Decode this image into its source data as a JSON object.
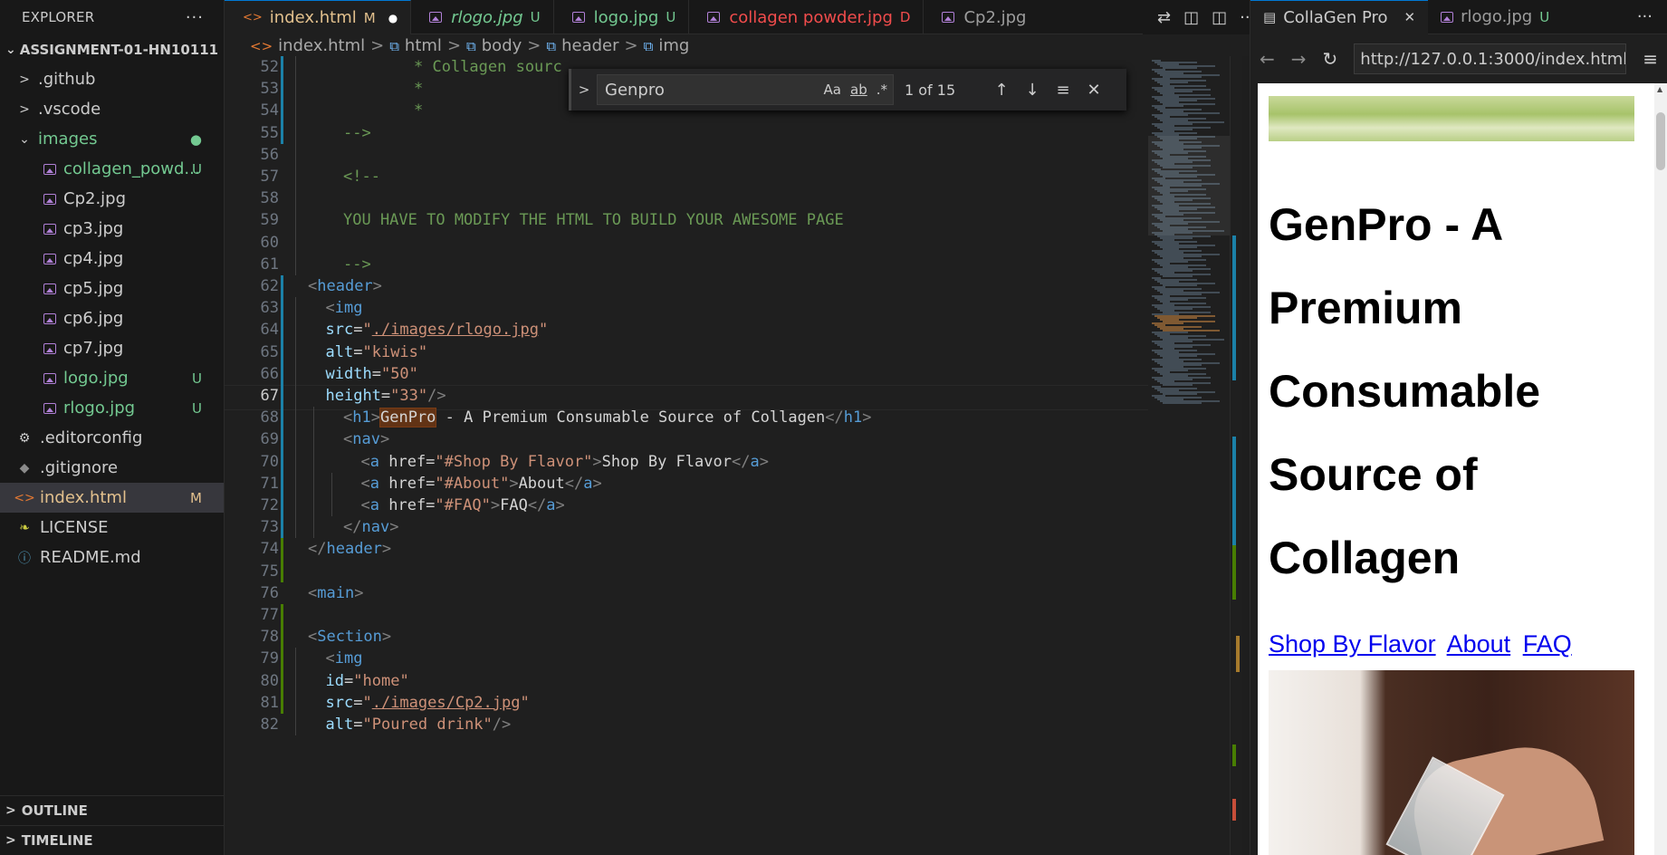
{
  "explorer": {
    "title": "EXPLORER",
    "more": "···",
    "root_folder": "ASSIGNMENT-01-HN10111",
    "items": [
      {
        "label": ".github",
        "type": "folder",
        "badge": ""
      },
      {
        "label": ".vscode",
        "type": "folder",
        "badge": ""
      },
      {
        "label": "images",
        "type": "folder-open",
        "badge": "●"
      },
      {
        "label": "collagen_powd...",
        "type": "image",
        "badge": "U"
      },
      {
        "label": "Cp2.jpg",
        "type": "image",
        "badge": ""
      },
      {
        "label": "cp3.jpg",
        "type": "image",
        "badge": ""
      },
      {
        "label": "cp4.jpg",
        "type": "image",
        "badge": ""
      },
      {
        "label": "cp5.jpg",
        "type": "image",
        "badge": ""
      },
      {
        "label": "cp6.jpg",
        "type": "image",
        "badge": ""
      },
      {
        "label": "cp7.jpg",
        "type": "image",
        "badge": ""
      },
      {
        "label": "logo.jpg",
        "type": "image",
        "badge": "U"
      },
      {
        "label": "rlogo.jpg",
        "type": "image",
        "badge": "U"
      },
      {
        "label": ".editorconfig",
        "type": "config",
        "badge": ""
      },
      {
        "label": ".gitignore",
        "type": "git",
        "badge": ""
      },
      {
        "label": "index.html",
        "type": "html",
        "badge": "M"
      },
      {
        "label": "LICENSE",
        "type": "license",
        "badge": ""
      },
      {
        "label": "README.md",
        "type": "info",
        "badge": ""
      }
    ],
    "outline": "OUTLINE",
    "timeline": "TIMELINE"
  },
  "editor_tabs": [
    {
      "label": "index.html",
      "badge": "M",
      "active": true
    },
    {
      "label": "rlogo.jpg",
      "badge": "U",
      "active": false
    },
    {
      "label": "logo.jpg",
      "badge": "U",
      "active": false
    },
    {
      "label": "collagen powder.jpg",
      "badge": "D",
      "active": false
    },
    {
      "label": "Cp2.jpg",
      "badge": "",
      "active": false
    }
  ],
  "tab_actions": [
    "compare-icon",
    "split-icon",
    "layout-icon",
    "···"
  ],
  "breadcrumb": [
    "index.html",
    "html",
    "body",
    "header",
    "img"
  ],
  "find_widget": {
    "query": "Genpro",
    "match_case": "Aa",
    "whole_word": "ab",
    "regex": ".*",
    "result": "1 of 15"
  },
  "code_lines": [
    {
      "n": "52",
      "text": "    * Collagen sourc"
    },
    {
      "n": "53",
      "text": "    *"
    },
    {
      "n": "54",
      "text": "    *"
    },
    {
      "n": "55",
      "text": "-->"
    },
    {
      "n": "56",
      "text": ""
    },
    {
      "n": "57",
      "text": "<!--"
    },
    {
      "n": "58",
      "text": ""
    },
    {
      "n": "59",
      "text": "  YOU HAVE TO MODIFY THE HTML TO BUILD YOUR AWESOME PAGE"
    },
    {
      "n": "60",
      "text": ""
    },
    {
      "n": "61",
      "text": "-->"
    },
    {
      "n": "62",
      "text": "<header>"
    },
    {
      "n": "63",
      "text": "<img"
    },
    {
      "n": "64",
      "text": "src=\"./images/rlogo.jpg\""
    },
    {
      "n": "65",
      "text": "alt=\"kiwis\""
    },
    {
      "n": "66",
      "text": "width=\"50\""
    },
    {
      "n": "67",
      "text": "height=\"33\"/>"
    },
    {
      "n": "68",
      "text": "<h1>GenPro - A Premium Consumable Source of Collagen</h1>"
    },
    {
      "n": "69",
      "text": "<nav>"
    },
    {
      "n": "70",
      "text": "<a href=\"#Shop By Flavor\">Shop By Flavor</a>"
    },
    {
      "n": "71",
      "text": "<a href=\"#About\">About</a>"
    },
    {
      "n": "72",
      "text": "<a href=\"#FAQ\">FAQ</a>"
    },
    {
      "n": "73",
      "text": "</nav>"
    },
    {
      "n": "74",
      "text": "</header>"
    },
    {
      "n": "75",
      "text": ""
    },
    {
      "n": "76",
      "text": "<main>"
    },
    {
      "n": "77",
      "text": ""
    },
    {
      "n": "78",
      "text": "<Section>"
    },
    {
      "n": "79",
      "text": "<img"
    },
    {
      "n": "80",
      "text": "id=\"home\""
    },
    {
      "n": "81",
      "text": "src=\"./images/Cp2.jpg\""
    },
    {
      "n": "82",
      "text": "alt=\"Poured drink\"/>"
    }
  ],
  "browser": {
    "tabs": [
      {
        "label": "CollaGen Pro",
        "active": true
      },
      {
        "label": "rlogo.jpg",
        "badge": "U",
        "active": false
      }
    ],
    "more": "···",
    "url": "http://127.0.0.1:3000/index.html",
    "page": {
      "heading": "GenPro - A Premium Consumable Source of Collagen",
      "nav": [
        "Shop By Flavor",
        "About",
        "FAQ"
      ]
    }
  },
  "colors": {
    "accent": "#0078d4",
    "untracked": "#73c991",
    "modified": "#e2c08d",
    "deleted": "#f14c4c",
    "match_highlight": "#623315"
  }
}
